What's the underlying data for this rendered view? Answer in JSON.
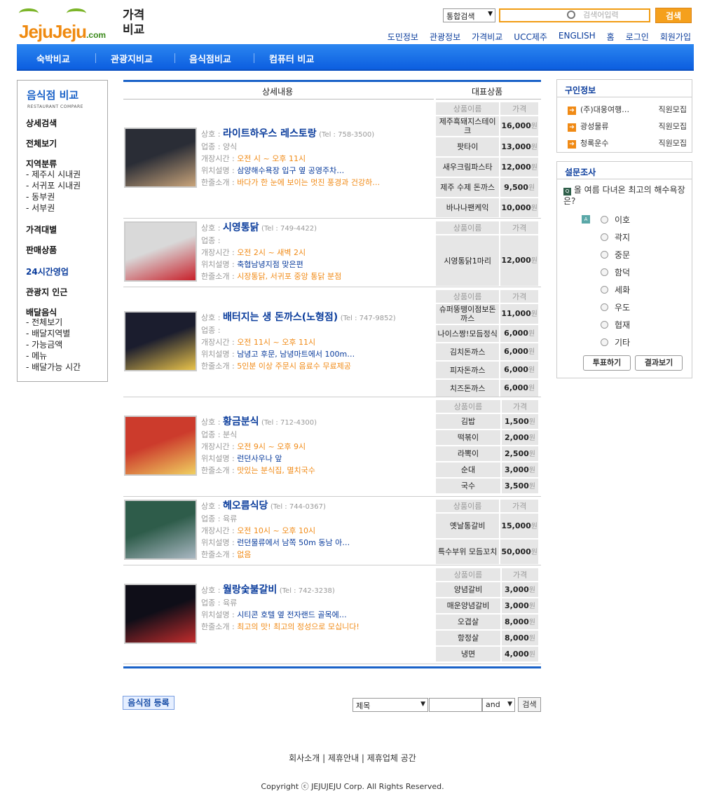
{
  "logo": {
    "text_main": "JejuJeju",
    "text_domain": ".com",
    "title": "가격\n비교"
  },
  "top_search": {
    "scope": "통합검색",
    "placeholder": "검색어입력",
    "button": "검색"
  },
  "top_nav": [
    "도민정보",
    "관광정보",
    "가격비교",
    "UCC제주",
    "ENGLISH",
    "홈",
    "로그인",
    "회원가입"
  ],
  "menu": [
    "숙박비교",
    "관광지비교",
    "음식점비교",
    "컴퓨터 비교"
  ],
  "left_nav": {
    "title": "음식점 비교",
    "subtitle": "RESTAURANT COMPARE",
    "detail_search": "상세검색",
    "view_all": "전체보기",
    "region_head": "지역분류",
    "regions": [
      "- 제주시 시내권",
      "- 서귀포 시내권",
      "- 동부권",
      "- 서부권"
    ],
    "price_range": "가격대별",
    "sale_items": "판매상품",
    "open_24h": "24시간영업",
    "near_tour": "관광지 인근",
    "delivery_head": "배달음식",
    "delivery": [
      "- 전체보기",
      "- 배달지역별",
      "- 가능금액",
      "- 메뉴",
      "- 배달가능 시간"
    ]
  },
  "table_header": {
    "detail": "상세내용",
    "products": "대표상품"
  },
  "labels": {
    "name": "상호 :",
    "type": "업종 :",
    "hours": "개장시간 :",
    "location": "위치설명 :",
    "intro": "한줄소개 :",
    "prod_name": "상품이름",
    "price": "가격",
    "won": "원"
  },
  "restaurants": [
    {
      "name": "라이트하우스 레스토랑",
      "tel": "(Tel : 758-3500)",
      "type": "양식",
      "hours": "오전 시 ~ 오후 11시",
      "location": "삼양해수욕장 입구 옆 공영주차…",
      "intro": "바다가 한 눈에 보이는 멋진 풍경과 건강하…",
      "products": [
        {
          "n": "제주흑돼지스테이크",
          "p": "16,000"
        },
        {
          "n": "팟타이",
          "p": "13,000"
        },
        {
          "n": "새우크림파스타",
          "p": "12,000"
        },
        {
          "n": "제주 수제 돈까스",
          "p": "9,500"
        },
        {
          "n": "바나나팬케익",
          "p": "10,000"
        }
      ]
    },
    {
      "name": "시영통닭",
      "tel": "(Tel : 749-4422)",
      "type": "",
      "hours": "오전 2시 ~ 새벽 2시",
      "location": "축협남녕지점 맞은편",
      "intro": "시장통닭, 서귀포 중앙 통닭 분점",
      "products": [
        {
          "n": "시영통닭1마리",
          "p": "12,000"
        }
      ]
    },
    {
      "name": "배터지는 생 돈까스(노형점)",
      "tel": "(Tel : 747-9852)",
      "type": "",
      "hours": "오전 11시 ~ 오후 11시",
      "location": "남녕고 후문, 남녕마트에서 100m…",
      "intro": "5인분 이상 주문시 음료수 무료제공",
      "products": [
        {
          "n": "슈퍼뚱뗑이점보돈까스",
          "p": "11,000"
        },
        {
          "n": "나이스짱!모듬정식",
          "p": "6,000"
        },
        {
          "n": "김치돈까스",
          "p": "6,000"
        },
        {
          "n": "피자돈까스",
          "p": "6,000"
        },
        {
          "n": "치즈돈까스",
          "p": "6,000"
        }
      ]
    },
    {
      "name": "황금분식",
      "tel": "(Tel : 712-4300)",
      "type": "분식",
      "hours": "오전 9시 ~ 오후 9시",
      "location": "런던사우나 앞",
      "intro": "맛있는 분식집, 멸치국수",
      "products": [
        {
          "n": "김밥",
          "p": "1,500"
        },
        {
          "n": "떡볶이",
          "p": "2,000"
        },
        {
          "n": "라뽁이",
          "p": "2,500"
        },
        {
          "n": "순대",
          "p": "3,000"
        },
        {
          "n": "국수",
          "p": "3,500"
        }
      ]
    },
    {
      "name": "헤오름식당",
      "tel": "(Tel : 744-0367)",
      "type": "육류",
      "hours": "오전 10시 ~ 오후 10시",
      "location": "런던물류에서 남쪽 50m 동남 아…",
      "intro": "없음",
      "products": [
        {
          "n": "옛날통갈비",
          "p": "15,000"
        },
        {
          "n": "특수부위 모듬꼬치",
          "p": "50,000"
        }
      ]
    },
    {
      "name": "월랑숯불갈비",
      "tel": "(Tel : 742-3238)",
      "type": "육류",
      "hours": "",
      "location": "시티콘 호텔 옆 전자랜드 골목에…",
      "intro": "최고의 맛! 최고의 정성으로 모십니다!",
      "products": [
        {
          "n": "양념갈비",
          "p": "3,000"
        },
        {
          "n": "매운양념갈비",
          "p": "3,000"
        },
        {
          "n": "오겹살",
          "p": "8,000"
        },
        {
          "n": "항정살",
          "p": "8,000"
        },
        {
          "n": "냉면",
          "p": "4,000"
        }
      ]
    }
  ],
  "bottom": {
    "register": "음식점 등록",
    "field": "제목",
    "op": "and",
    "button": "검색"
  },
  "jobs": {
    "title": "구인정보",
    "items": [
      {
        "company": "(주)대웅여행…",
        "tag": "직원모집"
      },
      {
        "company": "광성물류",
        "tag": "직원모집"
      },
      {
        "company": "청록운수",
        "tag": "직원모집"
      }
    ]
  },
  "poll": {
    "title": "설문조사",
    "question": "올 여름 다녀온 최고의 해수욕장은?",
    "options": [
      "이호",
      "곽지",
      "중문",
      "함덕",
      "세화",
      "우도",
      "협재",
      "기타"
    ],
    "vote": "투표하기",
    "result": "결과보기"
  },
  "footer": {
    "links": "회사소개 | 제휴안내 | 제휴업체 공간",
    "copyright": "Copyright ⓒ JEJUJEJU Corp. All Rights Reserved."
  }
}
